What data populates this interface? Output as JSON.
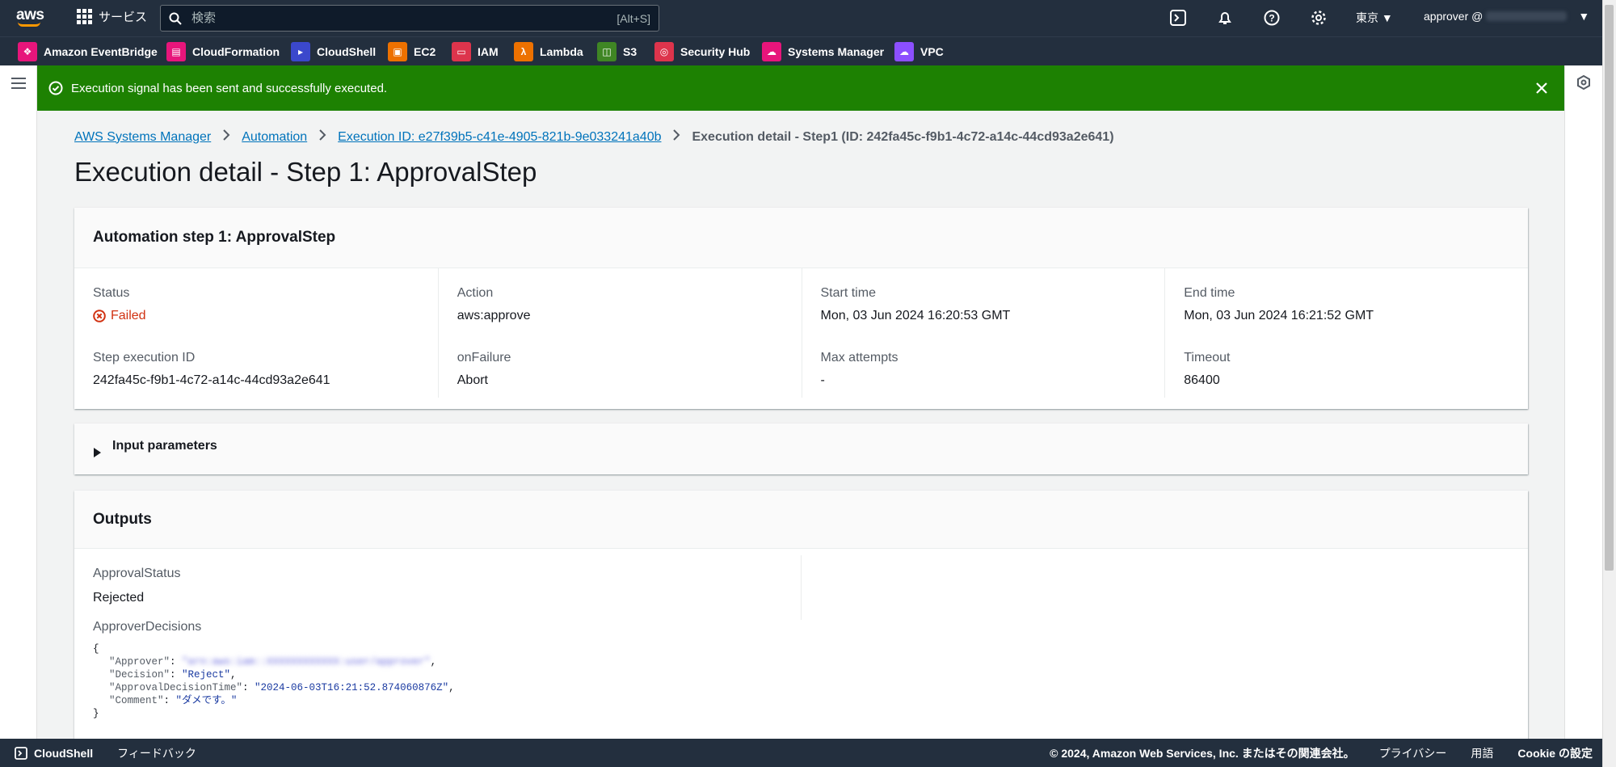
{
  "topnav": {
    "logo": "aws",
    "services_label": "サービス",
    "search_placeholder": "検索",
    "search_shortcut": "[Alt+S]",
    "region": "東京 ▼",
    "user": "approver @",
    "user_caret": "▼"
  },
  "favorites": [
    {
      "label": "Amazon EventBridge",
      "color": "#e7157b",
      "icon": "eventbridge-icon"
    },
    {
      "label": "CloudFormation",
      "color": "#e7157b",
      "icon": "cloudformation-icon"
    },
    {
      "label": "CloudShell",
      "color": "#3b48cc",
      "icon": "cloudshell-icon"
    },
    {
      "label": "EC2",
      "color": "#ed7100",
      "icon": "ec2-icon"
    },
    {
      "label": "IAM",
      "color": "#dd344c",
      "icon": "iam-icon"
    },
    {
      "label": "Lambda",
      "color": "#ed7100",
      "icon": "lambda-icon"
    },
    {
      "label": "S3",
      "color": "#3f8624",
      "icon": "s3-icon"
    },
    {
      "label": "Security Hub",
      "color": "#dd344c",
      "icon": "security-hub-icon"
    },
    {
      "label": "Systems Manager",
      "color": "#e7157b",
      "icon": "systems-manager-icon"
    },
    {
      "label": "VPC",
      "color": "#8c4fff",
      "icon": "vpc-icon"
    }
  ],
  "flash": {
    "message": "Execution signal has been sent and successfully executed.",
    "color": "#1d8102"
  },
  "breadcrumb": {
    "items": [
      "AWS Systems Manager",
      "Automation",
      "Execution ID: e27f39b5-c41e-4905-821b-9e033241a40b"
    ],
    "current": "Execution detail - Step1 (ID: 242fa45c-f9b1-4c72-a14c-44cd93a2e641)"
  },
  "page_title": "Execution detail - Step 1: ApprovalStep",
  "step": {
    "title": "Automation step 1: ApprovalStep",
    "row1": [
      {
        "label": "Status",
        "value": "Failed"
      },
      {
        "label": "Action",
        "value": "aws:approve"
      },
      {
        "label": "Start time",
        "value": "Mon, 03 Jun 2024 16:20:53 GMT"
      },
      {
        "label": "End time",
        "value": "Mon, 03 Jun 2024 16:21:52 GMT"
      }
    ],
    "row2": [
      {
        "label": "Step execution ID",
        "value": "242fa45c-f9b1-4c72-a14c-44cd93a2e641"
      },
      {
        "label": "onFailure",
        "value": "Abort"
      },
      {
        "label": "Max attempts",
        "value": "-"
      },
      {
        "label": "Timeout",
        "value": "86400"
      }
    ]
  },
  "input_parameters": {
    "label": "Input parameters"
  },
  "outputs": {
    "title": "Outputs",
    "approval_status_label": "ApprovalStatus",
    "approval_status_value": "Rejected",
    "approver_decisions_label": "ApproverDecisions",
    "json": {
      "open": "{",
      "close": "}",
      "approver_key": "\"Approver\"",
      "decision_key": "\"Decision\"",
      "decision_value": "\"Reject\"",
      "time_key": "\"ApprovalDecisionTime\"",
      "time_value": "\"2024-06-03T16:21:52.874060876Z\"",
      "comment_key": "\"Comment\"",
      "comment_value": "\"ダメです。\""
    }
  },
  "footer": {
    "cloudshell": "CloudShell",
    "feedback": "フィードバック",
    "copyright": "© 2024, Amazon Web Services, Inc. またはその関連会社。",
    "privacy": "プライバシー",
    "terms": "用語",
    "cookie": "Cookie の設定"
  }
}
